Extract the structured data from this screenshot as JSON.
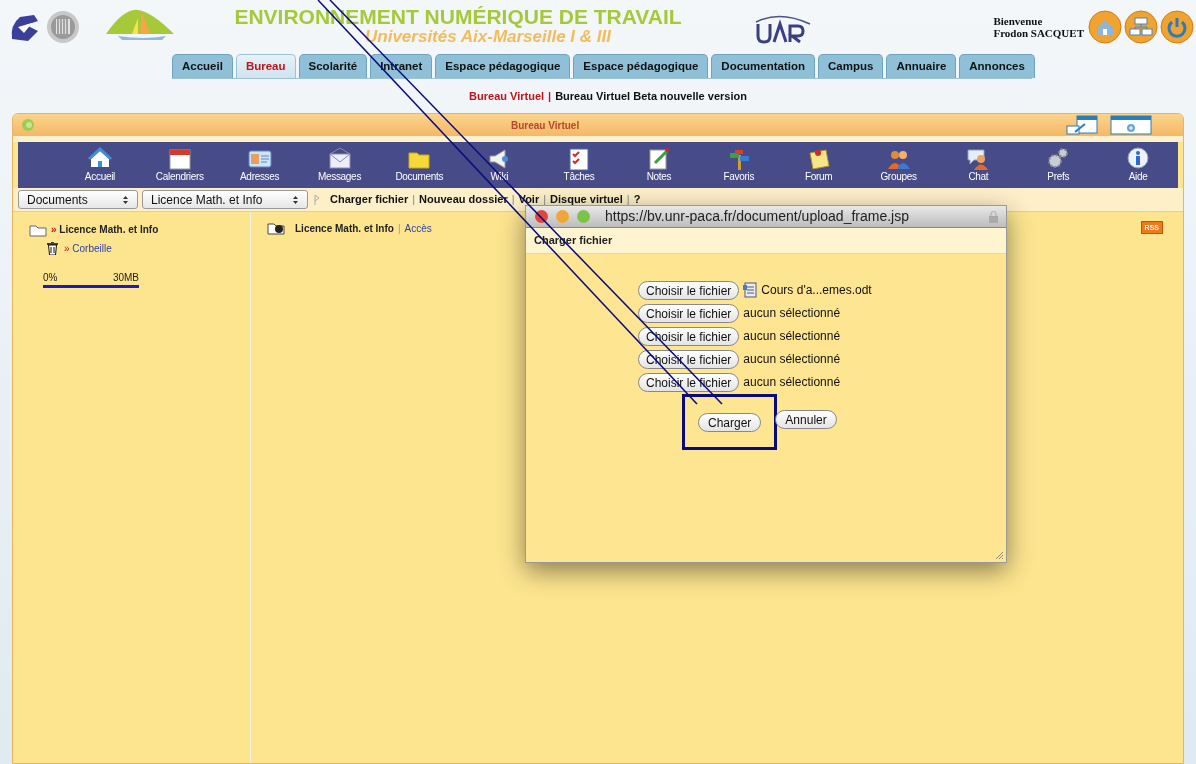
{
  "header": {
    "title": "ENVIRONNEMENT NUMÉRIQUE DE TRAVAIL",
    "subtitle": "Universités Aix-Marseille I & III",
    "welcome": "Bienvenue",
    "user": "Frodon SACQUET"
  },
  "tabs": [
    {
      "label": "Accueil",
      "selected": false
    },
    {
      "label": "Bureau",
      "selected": true
    },
    {
      "label": "Scolarité",
      "selected": false
    },
    {
      "label": "Intranet",
      "selected": false
    },
    {
      "label": "Espace pédagogique",
      "selected": false
    },
    {
      "label": "Espace pédagogique",
      "selected": false
    },
    {
      "label": "Documentation",
      "selected": false
    },
    {
      "label": "Campus",
      "selected": false
    },
    {
      "label": "Annuaire",
      "selected": false
    },
    {
      "label": "Annonces",
      "selected": false
    }
  ],
  "breadcrumb": {
    "current": "Bureau Virtuel",
    "separator": "|",
    "other": "Bureau Virtuel Beta nouvelle version"
  },
  "portlet": {
    "title": "Bureau Virtuel"
  },
  "nav": [
    {
      "label": "Accueil",
      "kind": "house"
    },
    {
      "label": "Calendriers",
      "kind": "calendar"
    },
    {
      "label": "Adresses",
      "kind": "card"
    },
    {
      "label": "Messages",
      "kind": "envelope"
    },
    {
      "label": "Documents",
      "kind": "folder"
    },
    {
      "label": "Wiki",
      "kind": "megaphone"
    },
    {
      "label": "Tâches",
      "kind": "checklist"
    },
    {
      "label": "Notes",
      "kind": "notepad"
    },
    {
      "label": "Favoris",
      "kind": "signpost"
    },
    {
      "label": "Forum",
      "kind": "note"
    },
    {
      "label": "Groupes",
      "kind": "people"
    },
    {
      "label": "Chat",
      "kind": "chat"
    },
    {
      "label": "Prefs",
      "kind": "gears"
    },
    {
      "label": "Aide",
      "kind": "info"
    }
  ],
  "toolbar": {
    "selects": [
      "Documents",
      "Licence Math. et Info"
    ],
    "separator": "|",
    "links": [
      "Charger fichier",
      "Nouveau dossier",
      "Voir",
      "Disque virtuel",
      "?"
    ]
  },
  "tree": {
    "marker": "»",
    "label": "Licence Math. et Info",
    "children": [
      {
        "marker": "»",
        "label": "Corbeille"
      }
    ]
  },
  "quota": {
    "min": "0%",
    "max": "30MB",
    "level": 0
  },
  "folder": {
    "name": "Licence Math. et Info",
    "separator": "|",
    "link": "Accès"
  },
  "rss": "RSS",
  "dialog": {
    "url": "https://bv.unr-paca.fr/document/upload_frame.jsp",
    "title": "Charger fichier",
    "files": [
      {
        "button": "Choisir le fichier",
        "kind": "file",
        "text": "Cours d'a...emes.odt"
      },
      {
        "button": "Choisir le fichier",
        "kind": "none",
        "text": "aucun sélectionné"
      },
      {
        "button": "Choisir le fichier",
        "kind": "none",
        "text": "aucun sélectionné"
      },
      {
        "button": "Choisir le fichier",
        "kind": "none",
        "text": "aucun sélectionné"
      },
      {
        "button": "Choisir le fichier",
        "kind": "none",
        "text": "aucun sélectionné"
      }
    ],
    "buttons": [
      {
        "label": "Charger",
        "highlighted": true
      },
      {
        "label": "Annuler",
        "highlighted": false
      }
    ]
  }
}
